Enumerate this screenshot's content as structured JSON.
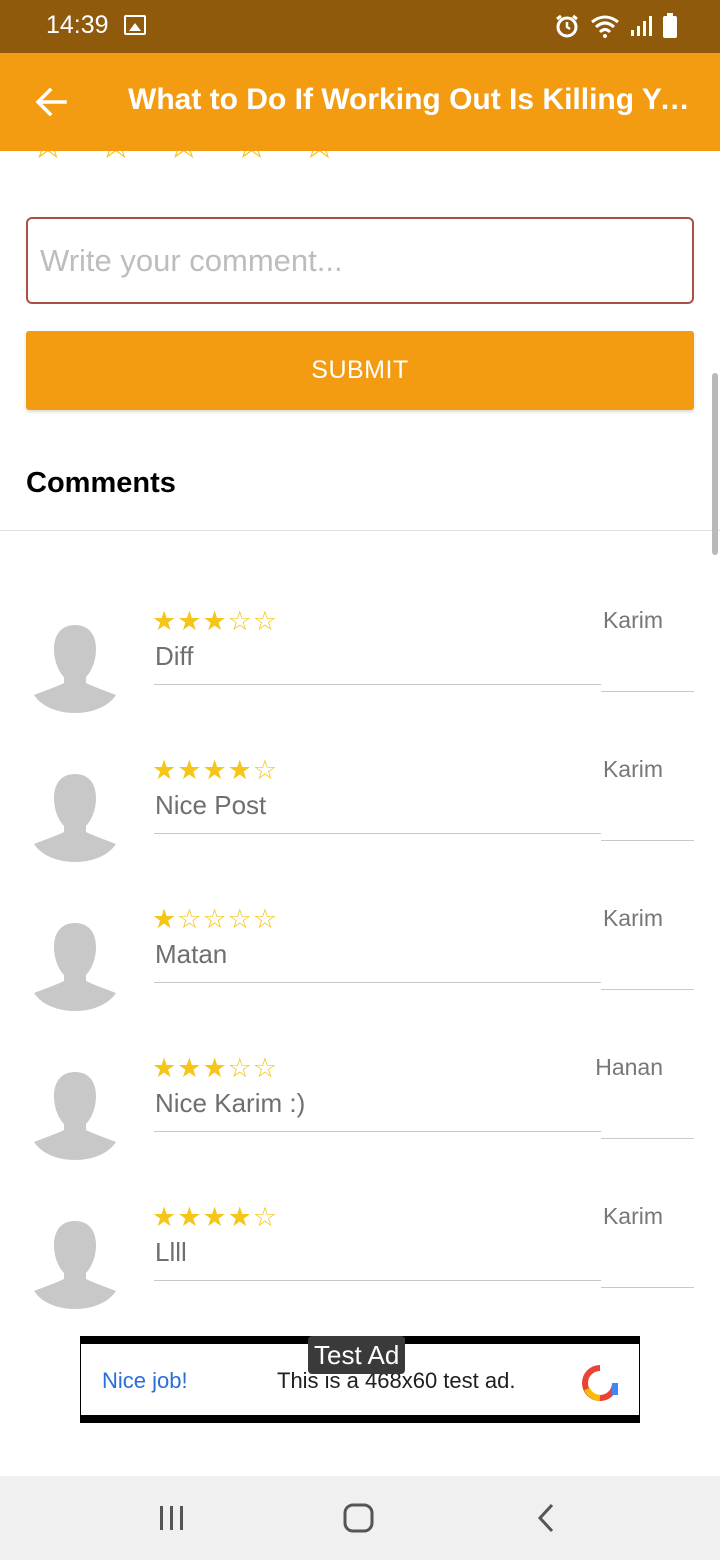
{
  "status_bar": {
    "time": "14:39",
    "icons": [
      "image-icon",
      "alarm-icon",
      "wifi-icon",
      "signal-icon",
      "battery-icon"
    ]
  },
  "app_bar": {
    "title": "What to Do If Working Out Is Killing Your Joints",
    "back_icon": "arrow-left-icon"
  },
  "rating_input": {
    "stars": 5,
    "selected": 0
  },
  "comment_form": {
    "placeholder": "Write your comment...",
    "value": "",
    "submit_label": "SUBMIT"
  },
  "comments_section": {
    "heading": "Comments",
    "items": [
      {
        "rating": 3,
        "text": "Diff",
        "author": "Karim"
      },
      {
        "rating": 4,
        "text": "Nice Post",
        "author": "Karim"
      },
      {
        "rating": 1,
        "text": "Matan",
        "author": "Karim"
      },
      {
        "rating": 3,
        "text": "Nice Karim :)",
        "author": "Hanan"
      },
      {
        "rating": 4,
        "text": "Llll",
        "author": "Karim"
      }
    ]
  },
  "ad": {
    "label": "Test Ad",
    "headline": "Nice job!",
    "text": "This is a 468x60 test ad."
  },
  "nav_bar": {
    "buttons": [
      "recent-apps-icon",
      "home-icon",
      "back-icon"
    ]
  },
  "colors": {
    "status_bar": "#8f5a0c",
    "accent": "#f39c12",
    "star": "#f5c518",
    "input_border": "#a8504a"
  }
}
